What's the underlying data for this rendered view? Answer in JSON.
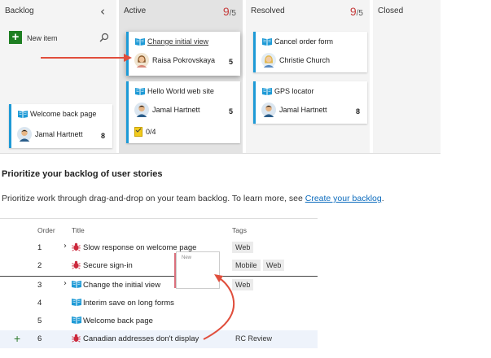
{
  "board": {
    "columns": [
      {
        "name": "Backlog"
      },
      {
        "name": "Active",
        "count": "9",
        "limit": "/5"
      },
      {
        "name": "Resolved",
        "count": "9",
        "limit": "/5"
      },
      {
        "name": "Closed"
      }
    ],
    "new_item_label": "New item",
    "cards": {
      "welcome": {
        "title": "Welcome back page",
        "assignee": "Jamal Hartnett",
        "points": "8"
      },
      "change": {
        "title": "Change initial view",
        "assignee": "Raisa Pokrovskaya",
        "points": "5"
      },
      "hello": {
        "title": "Hello World web site",
        "assignee": "Jamal Hartnett",
        "points": "5",
        "tasks": "0/4"
      },
      "cancel": {
        "title": "Cancel order form",
        "assignee": "Christie Church"
      },
      "gps": {
        "title": "GPS locator",
        "assignee": "Jamal Hartnett",
        "points": "8"
      }
    }
  },
  "section": {
    "heading": "Prioritize your backlog of user stories",
    "paragraph": "Prioritize work through drag-and-drop on your team backlog. To learn more, see ",
    "link": "Create your backlog",
    "period": "."
  },
  "backlog_list": {
    "headers": {
      "order": "Order",
      "title": "Title",
      "tags": "Tags"
    },
    "rows": [
      {
        "order": "1",
        "title": "Slow response on welcome page",
        "tags": [
          "Web"
        ]
      },
      {
        "order": "2",
        "title": "Secure sign-in",
        "tags": [
          "Mobile",
          "Web"
        ]
      },
      {
        "order": "3",
        "title": "Change the initial view",
        "tags": [
          "Web"
        ]
      },
      {
        "order": "4",
        "title": "Interim save on long forms",
        "tags": []
      },
      {
        "order": "5",
        "title": "Welcome back page",
        "tags": []
      },
      {
        "order": "6",
        "title": "Canadian addresses don't display",
        "tags": [
          "RC Review"
        ]
      }
    ],
    "ghost_label": "New"
  },
  "colors": {
    "accent": "#1e9ad6",
    "bug": "#cc293d",
    "green": "#1e7f22",
    "arrow": "#e04e3c"
  }
}
